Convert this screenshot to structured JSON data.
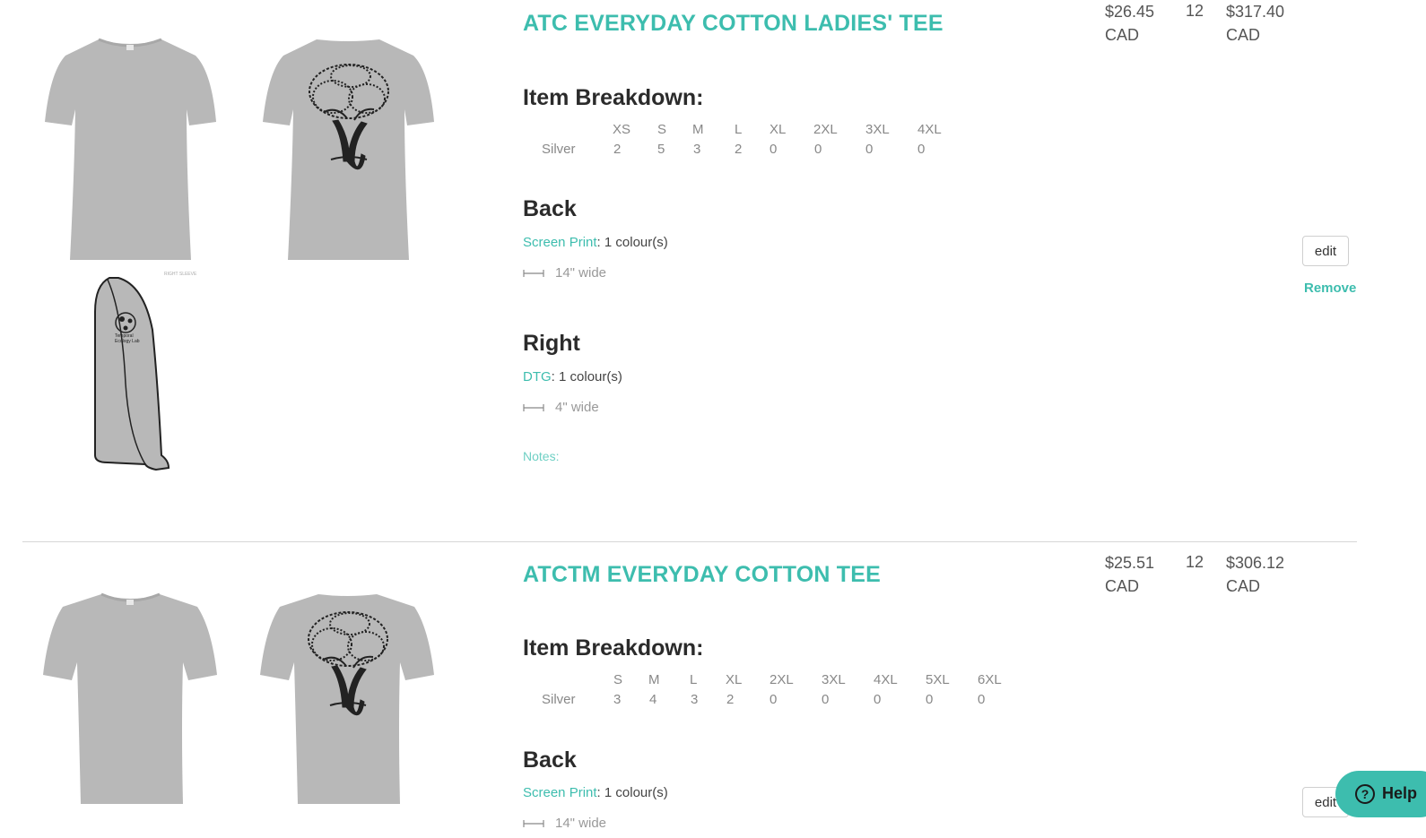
{
  "items": [
    {
      "title": "ATC EVERYDAY COTTON LADIES' TEE",
      "unit_price": "$26.45",
      "unit_currency": "CAD",
      "quantity": "12",
      "total_price": "$317.40",
      "total_currency": "CAD",
      "breakdown_heading": "Item Breakdown:",
      "color_name": "Silver",
      "sizes": [
        "XS",
        "S",
        "M",
        "L",
        "XL",
        "2XL",
        "3XL",
        "4XL"
      ],
      "counts": [
        "2",
        "5",
        "3",
        "2",
        "0",
        "0",
        "0",
        "0"
      ],
      "locations": [
        {
          "name": "Back",
          "method": "Screen Print",
          "colours": ": 1 colour(s)",
          "width": "14\" wide"
        },
        {
          "name": "Right",
          "method": "DTG",
          "colours": ": 1 colour(s)",
          "width": "4\" wide"
        }
      ],
      "notes_label": "Notes:",
      "edit_label": "edit",
      "remove_label": "Remove",
      "sleeve_caption": "RIGHT SLEEVE",
      "sleeve_logo_text": "Temporal Ecology Lab",
      "shirt_color": "#b8b8b8"
    },
    {
      "title": "ATCTM EVERYDAY COTTON TEE",
      "unit_price": "$25.51",
      "unit_currency": "CAD",
      "quantity": "12",
      "total_price": "$306.12",
      "total_currency": "CAD",
      "breakdown_heading": "Item Breakdown:",
      "color_name": "Silver",
      "sizes": [
        "S",
        "M",
        "L",
        "XL",
        "2XL",
        "3XL",
        "4XL",
        "5XL",
        "6XL"
      ],
      "counts": [
        "3",
        "4",
        "3",
        "2",
        "0",
        "0",
        "0",
        "0",
        "0"
      ],
      "locations": [
        {
          "name": "Back",
          "method": "Screen Print",
          "colours": ": 1 colour(s)",
          "width": "14\" wide"
        }
      ],
      "edit_label": "edit",
      "shirt_color": "#b8b8b8"
    }
  ],
  "help_widget": {
    "label": "Help",
    "icon": "question-icon"
  },
  "accent_color": "#3dbdae"
}
